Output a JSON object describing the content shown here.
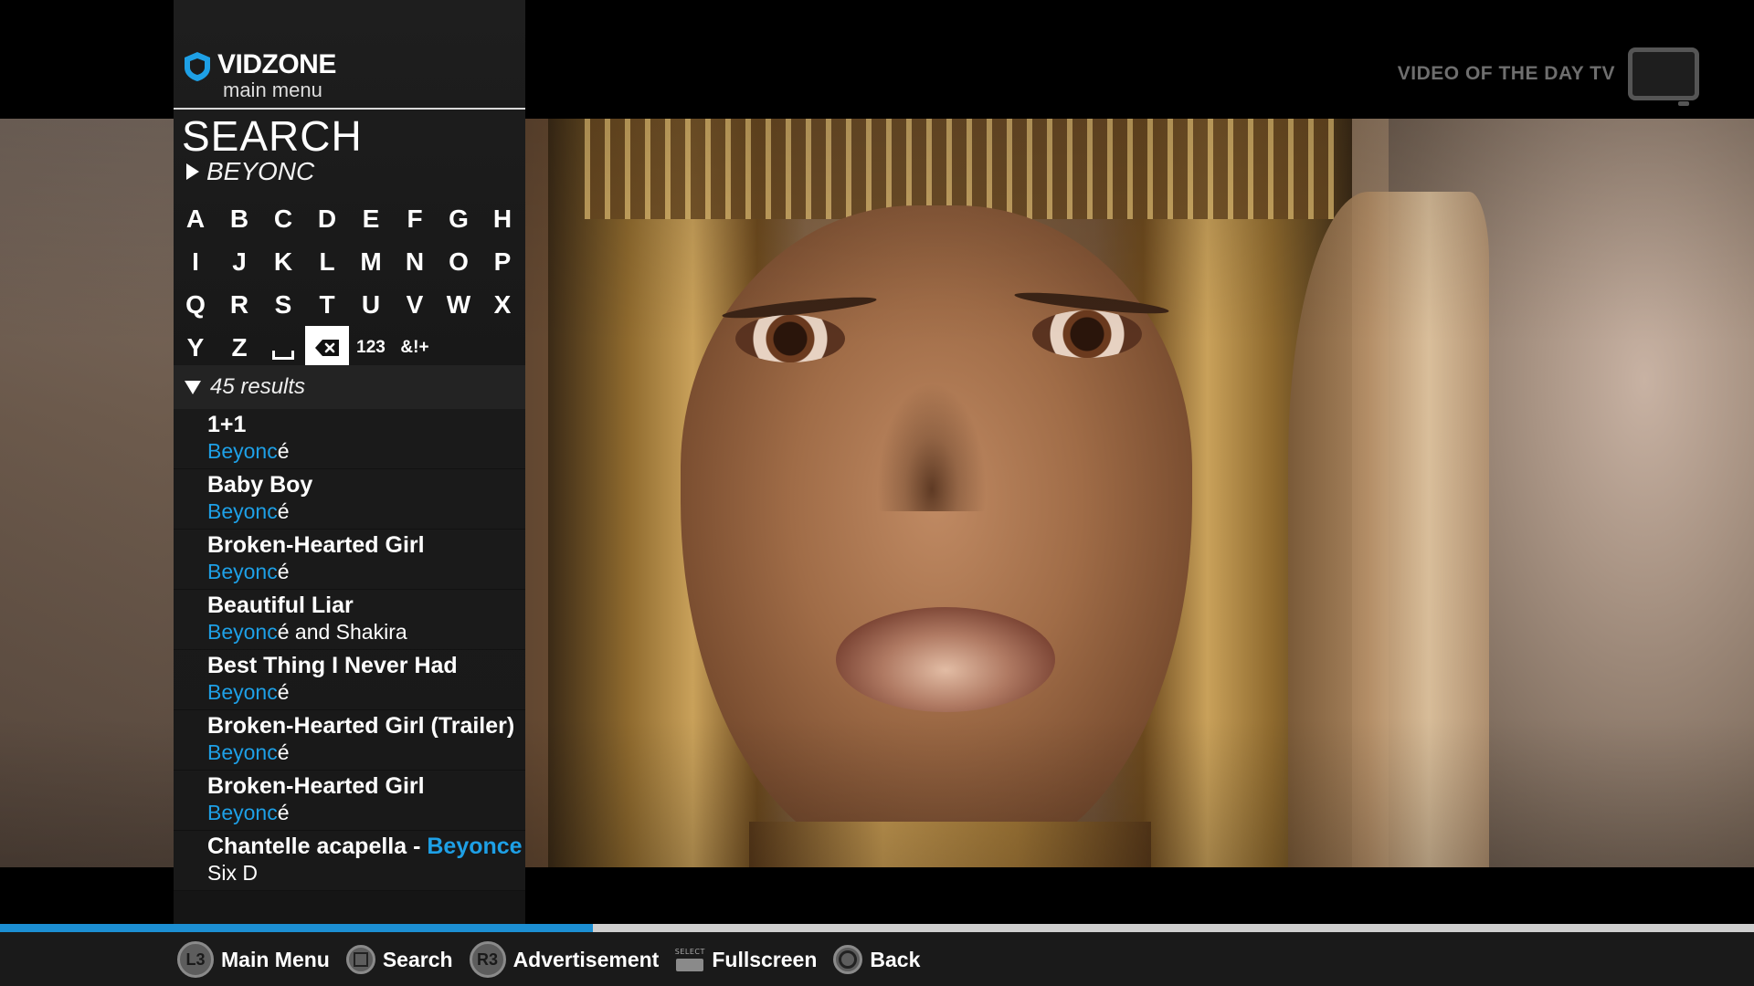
{
  "brand": {
    "name": "VIDZONE",
    "menu_label": "main menu",
    "accent_color": "#1ea0e6"
  },
  "channel_badge": {
    "label": "VIDEO OF THE DAY TV",
    "icon": "tv-icon"
  },
  "search": {
    "title": "SEARCH",
    "query": "BEYONC",
    "keyboard": {
      "rows": [
        [
          "A",
          "B",
          "C",
          "D",
          "E",
          "F",
          "G",
          "H"
        ],
        [
          "I",
          "J",
          "K",
          "L",
          "M",
          "N",
          "O",
          "P"
        ],
        [
          "Q",
          "R",
          "S",
          "T",
          "U",
          "V",
          "W",
          "X"
        ],
        [
          "Y",
          "Z",
          "space-icon",
          "backspace-icon",
          "123",
          "&!+"
        ]
      ],
      "selected_key": "backspace-icon"
    },
    "results_count": "45 results",
    "results": [
      {
        "title": "1+1",
        "title_hl": "",
        "artist_hl": "Beyonc",
        "artist_rest": "é"
      },
      {
        "title": "Baby Boy",
        "title_hl": "",
        "artist_hl": "Beyonc",
        "artist_rest": "é"
      },
      {
        "title": "Broken-Hearted Girl",
        "title_hl": "",
        "artist_hl": "Beyonc",
        "artist_rest": "é"
      },
      {
        "title": "Beautiful Liar",
        "title_hl": "",
        "artist_hl": "Beyonc",
        "artist_rest": "é and Shakira"
      },
      {
        "title": "Best Thing I Never Had",
        "title_hl": "",
        "artist_hl": "Beyonc",
        "artist_rest": "é"
      },
      {
        "title": "Broken-Hearted Girl (Trailer)",
        "title_hl": "",
        "artist_hl": "Beyonc",
        "artist_rest": "é"
      },
      {
        "title": "Broken-Hearted Girl",
        "title_hl": "",
        "artist_hl": "Beyonc",
        "artist_rest": "é"
      },
      {
        "title": "Chantelle acapella - ",
        "title_hl": "Beyonce",
        "artist_hl": "",
        "artist_rest": "Six D"
      }
    ]
  },
  "playback": {
    "progress_fraction": 0.338,
    "progress_color": "#1c8fd3"
  },
  "controls": [
    {
      "button": "L3",
      "icon": "l3-stick-icon",
      "label": "Main Menu"
    },
    {
      "button": "",
      "icon": "square-button-icon",
      "label": "Search"
    },
    {
      "button": "R3",
      "icon": "r3-stick-icon",
      "label": "Advertisement"
    },
    {
      "button": "SELECT",
      "icon": "select-button-icon",
      "label": "Fullscreen"
    },
    {
      "button": "",
      "icon": "circle-button-icon",
      "label": "Back"
    }
  ]
}
